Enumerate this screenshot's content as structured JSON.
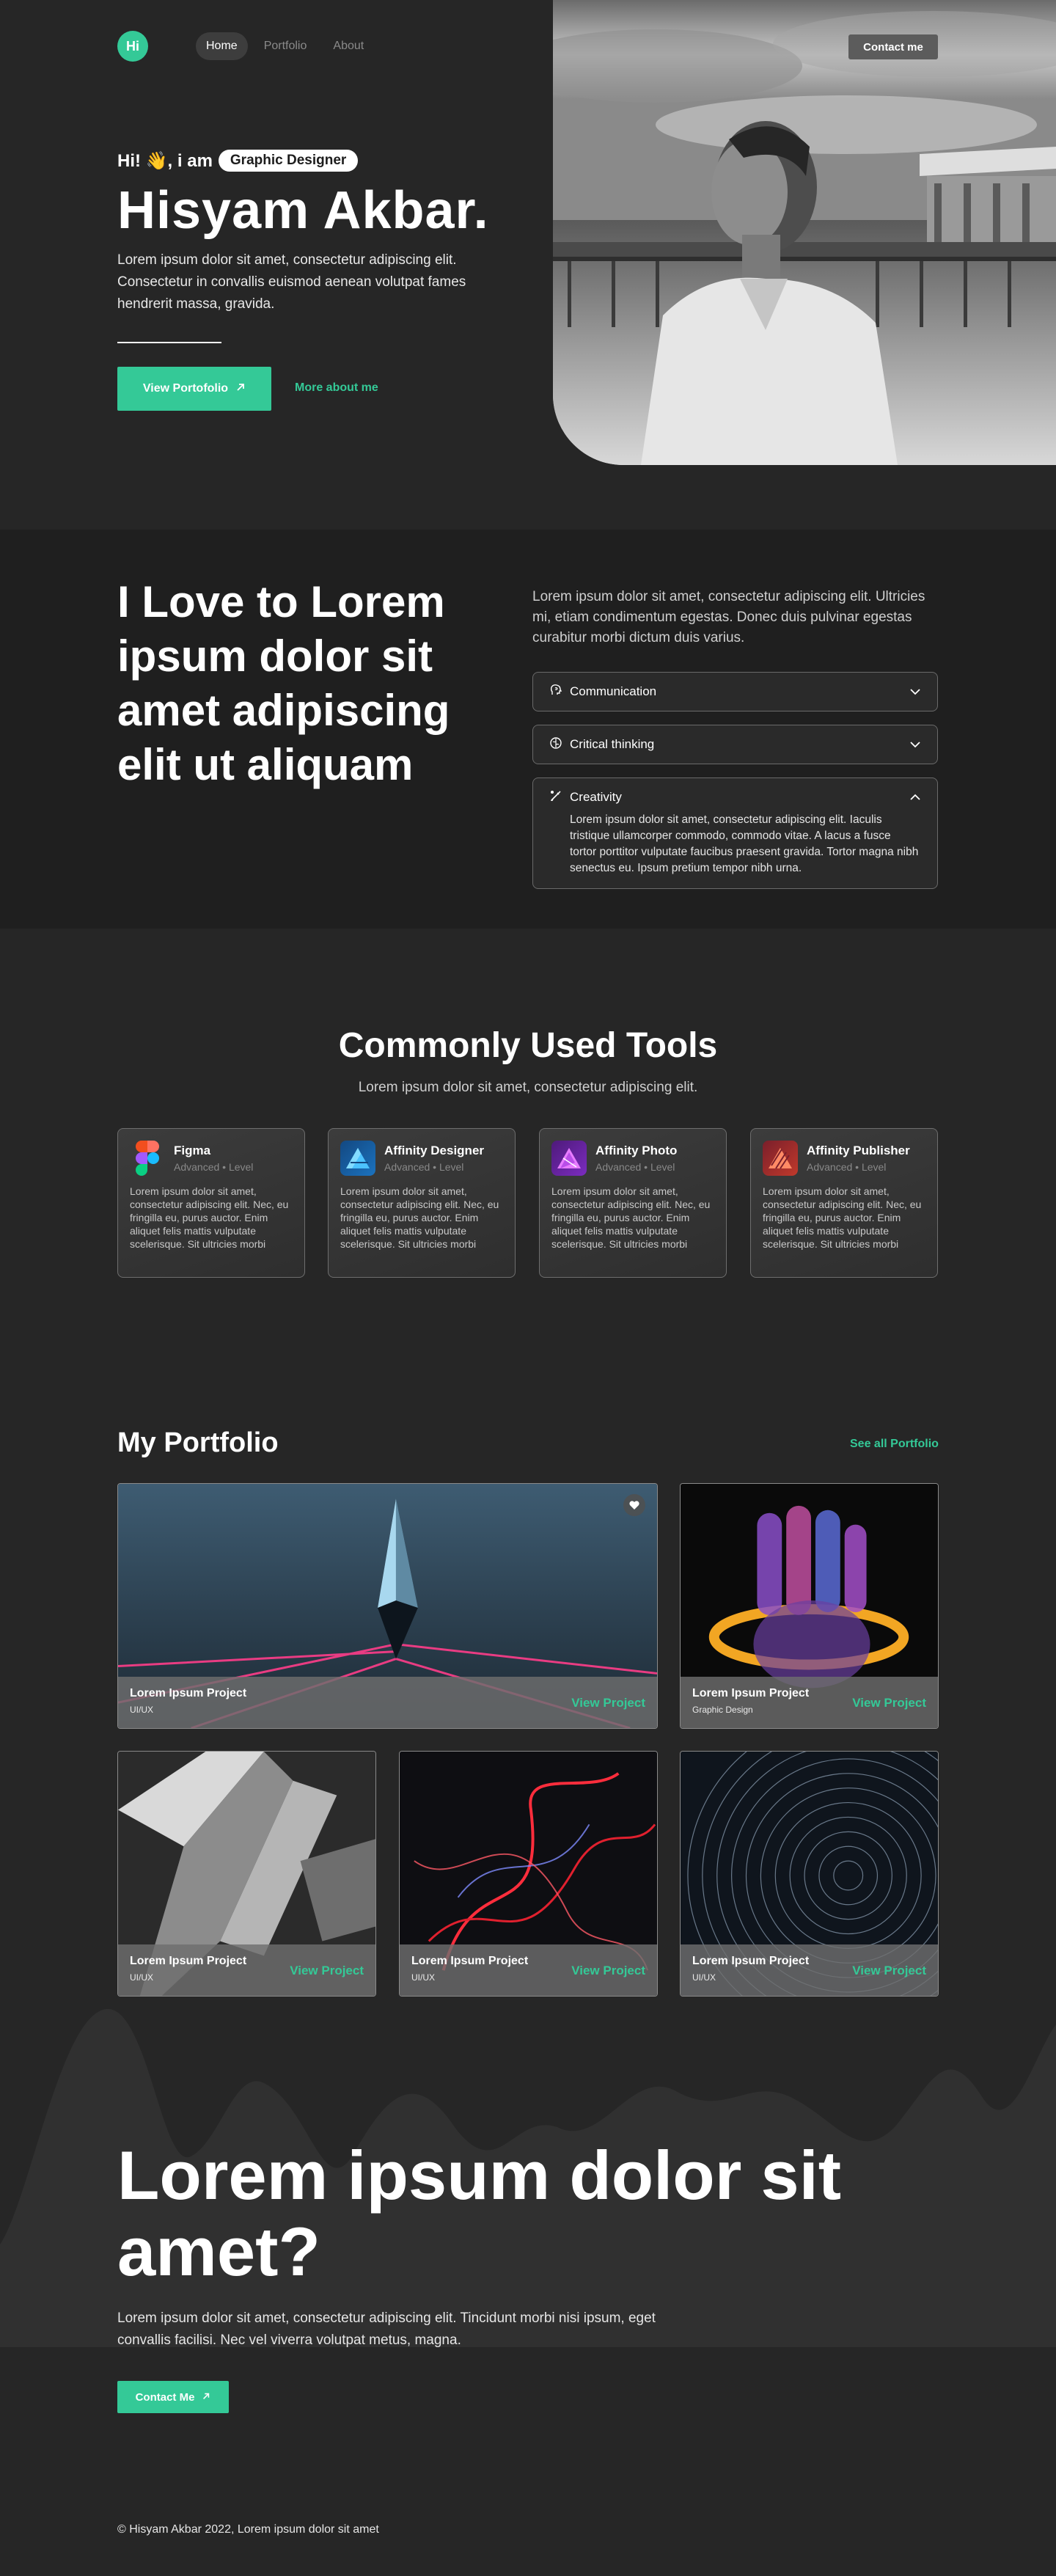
{
  "nav": {
    "logo": "Hi",
    "links": [
      {
        "label": "Home",
        "active": true
      },
      {
        "label": "Portfolio",
        "active": false
      },
      {
        "label": "About",
        "active": false
      }
    ],
    "contact_label": "Contact me"
  },
  "hero": {
    "greeting": "Hi! 👋, i am",
    "role": "Graphic Designer",
    "name": "Hisyam Akbar.",
    "description": "Lorem ipsum dolor sit amet, consectetur adipiscing elit. Consectetur in convallis euismod aenean volutpat fames hendrerit massa, gravida.",
    "primary_button": "View Portofolio",
    "secondary_link": "More about me"
  },
  "skills": {
    "title": "I Love to Lorem ipsum dolor sit amet adipiscing elit ut aliquam",
    "description": "Lorem ipsum dolor sit amet, consectetur adipiscing elit. Ultricies mi, etiam condimentum egestas. Donec duis pulvinar egestas curabitur morbi dictum duis varius.",
    "items": [
      {
        "label": "Communication",
        "icon": "speech-head-icon",
        "expanded": false
      },
      {
        "label": "Critical thinking",
        "icon": "brain-icon",
        "expanded": false
      },
      {
        "label": "Creativity",
        "icon": "paint-brush-icon",
        "expanded": true,
        "body": "Lorem ipsum dolor sit amet, consectetur adipiscing elit. Iaculis tristique ullamcorper commodo, commodo vitae. A lacus a fusce tortor porttitor vulputate faucibus praesent gravida. Tortor magna nibh senectus eu. Ipsum pretium tempor nibh urna."
      }
    ]
  },
  "tools": {
    "title": "Commonly Used Tools",
    "subtitle": "Lorem ipsum dolor sit amet, consectetur adipiscing elit.",
    "cards": [
      {
        "name": "Figma",
        "level": "Advanced • Level",
        "icon": "figma-icon",
        "desc": "Lorem ipsum dolor sit amet, consectetur adipiscing elit. Nec, eu fringilla eu, purus auctor. Enim aliquet felis mattis vulputate scelerisque. Sit ultricies morbi malesuada ame..."
      },
      {
        "name": "Affinity Designer",
        "level": "Advanced • Level",
        "icon": "affinity-designer-icon",
        "desc": "Lorem ipsum dolor sit amet, consectetur adipiscing elit. Nec, eu fringilla eu, purus auctor. Enim aliquet felis mattis vulputate scelerisque. Sit ultricies morbi malesuada ame..."
      },
      {
        "name": "Affinity Photo",
        "level": "Advanced • Level",
        "icon": "affinity-photo-icon",
        "desc": "Lorem ipsum dolor sit amet, consectetur adipiscing elit. Nec, eu fringilla eu, purus auctor. Enim aliquet felis mattis vulputate scelerisque. Sit ultricies morbi malesuada ame..."
      },
      {
        "name": "Affinity Publisher",
        "level": "Advanced • Level",
        "icon": "affinity-publisher-icon",
        "desc": "Lorem ipsum dolor sit amet, consectetur adipiscing elit. Nec, eu fringilla eu, purus auctor. Enim aliquet felis mattis vulputate scelerisque. Sit ultricies morbi malesuada ame..."
      }
    ]
  },
  "portfolio": {
    "title": "My Portfolio",
    "see_all": "See all Portfolio",
    "projects": [
      {
        "name": "Lorem Ipsum Project",
        "category": "UI/UX",
        "view": "View Project"
      },
      {
        "name": "Lorem Ipsum Project",
        "category": "Graphic Design",
        "view": "View Project"
      },
      {
        "name": "Lorem Ipsum Project",
        "category": "UI/UX",
        "view": "View Project"
      },
      {
        "name": "Lorem Ipsum Project",
        "category": "UI/UX",
        "view": "View Project"
      },
      {
        "name": "Lorem Ipsum Project",
        "category": "UI/UX",
        "view": "View Project"
      }
    ]
  },
  "cta": {
    "title": "Lorem ipsum dolor sit amet?",
    "description": "Lorem ipsum dolor sit amet, consectetur adipiscing elit. Tincidunt morbi nisi ipsum, eget convallis facilisi. Nec vel viverra volutpat metus, magna.",
    "button": "Contact Me"
  },
  "footer": {
    "text": "© Hisyam Akbar 2022, Lorem ipsum dolor sit amet"
  },
  "colors": {
    "accent": "#34c997",
    "background": "#262626",
    "section_dark": "#1f1f1f"
  }
}
